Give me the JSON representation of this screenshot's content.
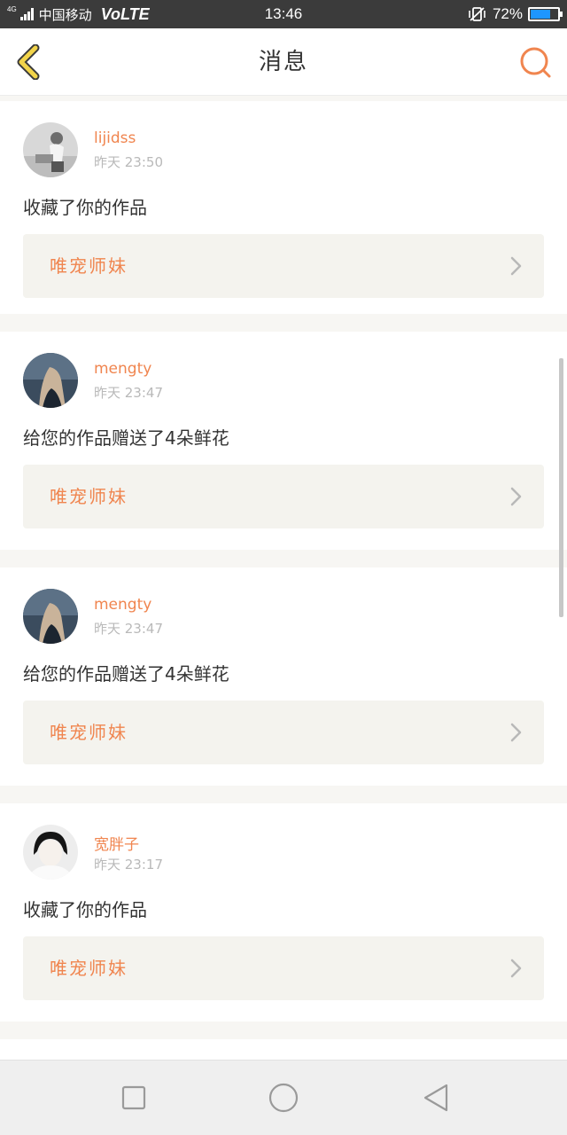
{
  "status_bar": {
    "network": "4G",
    "carrier": "中国移动",
    "volte": "VoLTE",
    "time": "13:46",
    "battery_percent": "72%",
    "battery_level": 0.72,
    "icons": [
      "signal-icon",
      "vibrate-icon",
      "battery-icon"
    ]
  },
  "header": {
    "title": "消息",
    "back_icon": "chevron-left-icon",
    "search_icon": "search-icon",
    "accent": "#f0854f"
  },
  "messages": [
    {
      "username": "lijidss",
      "time": "昨天 23:50",
      "action": "收藏了你的作品",
      "work": "唯宠师妹",
      "avatar_colors": [
        "#d9d9d9",
        "#8a8a8a"
      ]
    },
    {
      "username": "mengty",
      "time": "昨天 23:47",
      "action": "给您的作品赠送了4朵鲜花",
      "work": "唯宠师妹",
      "avatar_colors": [
        "#2d3d4e",
        "#c9b39a"
      ]
    },
    {
      "username": "mengty",
      "time": "昨天 23:47",
      "action": "给您的作品赠送了4朵鲜花",
      "work": "唯宠师妹",
      "avatar_colors": [
        "#2d3d4e",
        "#c9b39a"
      ]
    },
    {
      "username": "宽胖子",
      "time": "昨天 23:17",
      "action": "收藏了你的作品",
      "work": "唯宠师妹",
      "avatar_colors": [
        "#f2f2f2",
        "#1a1a1a"
      ]
    }
  ],
  "system_nav": {
    "icons": [
      "recent-apps-icon",
      "home-icon",
      "back-icon"
    ]
  }
}
